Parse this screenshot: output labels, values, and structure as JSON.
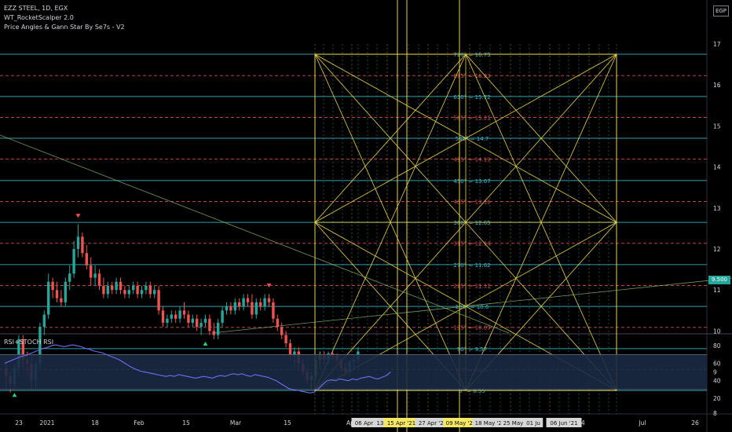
{
  "header": {
    "symbol": "EZZ STEEL, 1D, EGX",
    "indicator1": "WT_RocketScalper 2.0",
    "indicator2": "Price Angles & Gann Star By Se7s - V2",
    "currency": "EGP",
    "last_price": "9.500",
    "rsi_label": "RSI+STOCH RSI"
  },
  "colors": {
    "background": "#000000",
    "up_candle": "#26a69a",
    "down_candle": "#ef5350",
    "gann_yellow": "#e7d24d",
    "cyan_level": "#3fb8c8",
    "red_level": "#d9534f",
    "rsi_line": "#6f6cf0",
    "rsi_band": "#1b2a44",
    "price_tag": "#26a69a"
  },
  "chart_data": [
    {
      "type": "candlestick",
      "name": "price",
      "y_axis_ticks": [
        8,
        9,
        10,
        11,
        12,
        13,
        14,
        15,
        16,
        17
      ],
      "ylim": [
        7.8,
        17.5
      ],
      "x_axis_labels": [
        "23",
        "2021",
        "18",
        "Feb",
        "15",
        "Mar",
        "15",
        "Ap",
        "06 Apr '21",
        "13",
        "15 Apr '21",
        "27 Apr '21",
        "09 May '21",
        "18 May '21",
        "25 May '21",
        "01 Ju",
        "06 Jun '21",
        "14",
        "Jul",
        "26"
      ],
      "ohlc": [
        [
          9.1,
          9.3,
          8.6,
          8.9
        ],
        [
          8.9,
          9.0,
          8.5,
          8.7
        ],
        [
          8.7,
          9.2,
          8.6,
          9.1
        ],
        [
          9.1,
          9.9,
          8.9,
          9.8
        ],
        [
          9.8,
          9.9,
          9.1,
          9.3
        ],
        [
          9.3,
          9.5,
          8.9,
          9.2
        ],
        [
          9.2,
          9.4,
          8.6,
          8.8
        ],
        [
          8.8,
          9.3,
          8.6,
          9.2
        ],
        [
          9.2,
          10.2,
          9.1,
          10.1
        ],
        [
          10.1,
          10.5,
          9.9,
          10.4
        ],
        [
          10.4,
          11.4,
          10.3,
          11.2
        ],
        [
          11.2,
          11.3,
          10.8,
          11.0
        ],
        [
          11.0,
          11.2,
          10.7,
          10.8
        ],
        [
          10.8,
          11.0,
          10.6,
          10.7
        ],
        [
          10.7,
          11.3,
          10.6,
          11.2
        ],
        [
          11.2,
          11.6,
          11.0,
          11.4
        ],
        [
          11.4,
          12.2,
          11.3,
          12.0
        ],
        [
          12.0,
          12.6,
          11.8,
          12.3
        ],
        [
          12.3,
          12.4,
          11.8,
          11.9
        ],
        [
          11.9,
          12.1,
          11.5,
          11.6
        ],
        [
          11.6,
          11.8,
          11.1,
          11.3
        ],
        [
          11.3,
          11.6,
          11.1,
          11.4
        ],
        [
          11.4,
          11.5,
          11.0,
          11.1
        ],
        [
          11.1,
          11.3,
          10.8,
          10.9
        ],
        [
          10.9,
          11.2,
          10.8,
          11.1
        ],
        [
          11.1,
          11.2,
          10.9,
          11.0
        ],
        [
          11.0,
          11.3,
          10.9,
          11.2
        ],
        [
          11.2,
          11.3,
          10.9,
          11.0
        ],
        [
          11.0,
          11.1,
          10.8,
          10.9
        ],
        [
          10.9,
          11.1,
          10.8,
          11.0
        ],
        [
          11.0,
          11.2,
          10.9,
          11.1
        ],
        [
          11.1,
          11.2,
          10.8,
          10.9
        ],
        [
          10.9,
          11.1,
          10.8,
          11.0
        ],
        [
          11.0,
          11.2,
          10.9,
          11.1
        ],
        [
          11.1,
          11.2,
          10.8,
          10.9
        ],
        [
          10.9,
          11.1,
          10.8,
          11.0
        ],
        [
          11.0,
          11.1,
          10.4,
          10.5
        ],
        [
          10.5,
          10.6,
          10.1,
          10.2
        ],
        [
          10.2,
          10.4,
          10.1,
          10.3
        ],
        [
          10.3,
          10.5,
          10.2,
          10.4
        ],
        [
          10.4,
          10.5,
          10.2,
          10.3
        ],
        [
          10.3,
          10.6,
          10.2,
          10.5
        ],
        [
          10.5,
          10.7,
          10.3,
          10.4
        ],
        [
          10.4,
          10.5,
          10.1,
          10.2
        ],
        [
          10.2,
          10.4,
          10.1,
          10.3
        ],
        [
          10.3,
          10.4,
          10.0,
          10.1
        ],
        [
          10.1,
          10.3,
          9.9,
          10.2
        ],
        [
          10.2,
          10.4,
          10.1,
          10.3
        ],
        [
          10.3,
          10.4,
          9.9,
          10.0
        ],
        [
          10.0,
          10.2,
          9.8,
          9.9
        ],
        [
          9.9,
          10.3,
          9.8,
          10.2
        ],
        [
          10.2,
          10.6,
          10.1,
          10.5
        ],
        [
          10.5,
          10.7,
          10.4,
          10.6
        ],
        [
          10.6,
          10.7,
          10.4,
          10.5
        ],
        [
          10.5,
          10.8,
          10.4,
          10.7
        ],
        [
          10.7,
          10.8,
          10.5,
          10.6
        ],
        [
          10.6,
          10.9,
          10.5,
          10.8
        ],
        [
          10.8,
          10.9,
          10.6,
          10.7
        ],
        [
          10.7,
          10.9,
          10.3,
          10.4
        ],
        [
          10.4,
          10.8,
          10.3,
          10.7
        ],
        [
          10.7,
          10.8,
          10.5,
          10.6
        ],
        [
          10.6,
          10.9,
          10.5,
          10.8
        ],
        [
          10.8,
          10.9,
          10.6,
          10.7
        ],
        [
          10.7,
          10.8,
          10.2,
          10.3
        ],
        [
          10.3,
          10.4,
          10.0,
          10.1
        ],
        [
          10.1,
          10.2,
          9.8,
          9.9
        ],
        [
          9.9,
          10.0,
          9.6,
          9.7
        ],
        [
          9.7,
          9.8,
          9.3,
          9.4
        ],
        [
          9.4,
          9.6,
          9.1,
          9.5
        ],
        [
          9.5,
          9.6,
          9.1,
          9.2
        ],
        [
          9.2,
          9.3,
          8.9,
          9.0
        ],
        [
          9.0,
          9.1,
          8.7,
          8.8
        ],
        [
          8.8,
          9.0,
          8.6,
          8.9
        ],
        [
          8.9,
          9.4,
          8.8,
          9.3
        ],
        [
          9.3,
          9.5,
          9.1,
          9.4
        ],
        [
          9.4,
          9.5,
          9.2,
          9.3
        ],
        [
          9.3,
          9.5,
          9.2,
          9.45
        ],
        [
          9.45,
          9.5,
          9.3,
          9.4
        ],
        [
          9.4,
          9.45,
          9.2,
          9.3
        ],
        [
          9.3,
          9.35,
          9.0,
          9.1
        ],
        [
          9.1,
          9.2,
          8.9,
          9.0
        ],
        [
          9.0,
          9.3,
          8.9,
          9.25
        ],
        [
          9.25,
          9.4,
          9.1,
          9.3
        ],
        [
          9.3,
          9.6,
          9.2,
          9.5
        ]
      ]
    },
    {
      "type": "levels",
      "name": "gann_price_levels",
      "levels": [
        {
          "label": "720° = 16.75",
          "value": 16.75,
          "color": "cyan"
        },
        {
          "label": "675° = 16.23",
          "value": 16.23,
          "color": "red"
        },
        {
          "label": "630° = 15.72",
          "value": 15.72,
          "color": "cyan"
        },
        {
          "label": "585° = 15.21",
          "value": 15.21,
          "color": "red"
        },
        {
          "label": "540° = 14.7",
          "value": 14.7,
          "color": "cyan"
        },
        {
          "label": "495° = 14.19",
          "value": 14.19,
          "color": "red"
        },
        {
          "label": "450° = 13.67",
          "value": 13.67,
          "color": "cyan"
        },
        {
          "label": "405° = 13.16",
          "value": 13.16,
          "color": "red"
        },
        {
          "label": "360° = 12.65",
          "value": 12.65,
          "color": "cyan"
        },
        {
          "label": "315° = 12.14",
          "value": 12.14,
          "color": "red"
        },
        {
          "label": "270° = 11.62",
          "value": 11.62,
          "color": "cyan"
        },
        {
          "label": "225° = 11.11",
          "value": 11.11,
          "color": "red"
        },
        {
          "label": "180° = 10.6",
          "value": 10.6,
          "color": "cyan"
        },
        {
          "label": "135° = 10.09",
          "value": 10.09,
          "color": "red"
        },
        {
          "label": "90° = 9.57",
          "value": 9.57,
          "color": "cyan"
        },
        {
          "label": "45° = 9.06",
          "value": 9.06,
          "color": "red"
        },
        {
          "label": "0° = 8.55",
          "value": 8.55,
          "color": "cyan"
        }
      ]
    },
    {
      "type": "line",
      "name": "RSI",
      "y_axis_ticks": [
        20,
        40,
        60,
        80
      ],
      "ylim": [
        15,
        88
      ],
      "band": [
        30,
        70
      ],
      "values": [
        60,
        62,
        64,
        66,
        68,
        69,
        71,
        73,
        75,
        77,
        78,
        80,
        81,
        80,
        79,
        80,
        81,
        80,
        79,
        77,
        76,
        74,
        73,
        72,
        70,
        68,
        66,
        64,
        61,
        58,
        55,
        53,
        51,
        50,
        49,
        48,
        47,
        46,
        45,
        46,
        45,
        47,
        46,
        45,
        44,
        43,
        44,
        45,
        44,
        43,
        45,
        46,
        45,
        47,
        48,
        47,
        48,
        46,
        45,
        47,
        46,
        45,
        44,
        42,
        40,
        37,
        34,
        31,
        30,
        29,
        28,
        27,
        26,
        27,
        31,
        36,
        40,
        41,
        40,
        42,
        41,
        40,
        42,
        41,
        43,
        44,
        45,
        43,
        42,
        44,
        46,
        50
      ]
    }
  ]
}
